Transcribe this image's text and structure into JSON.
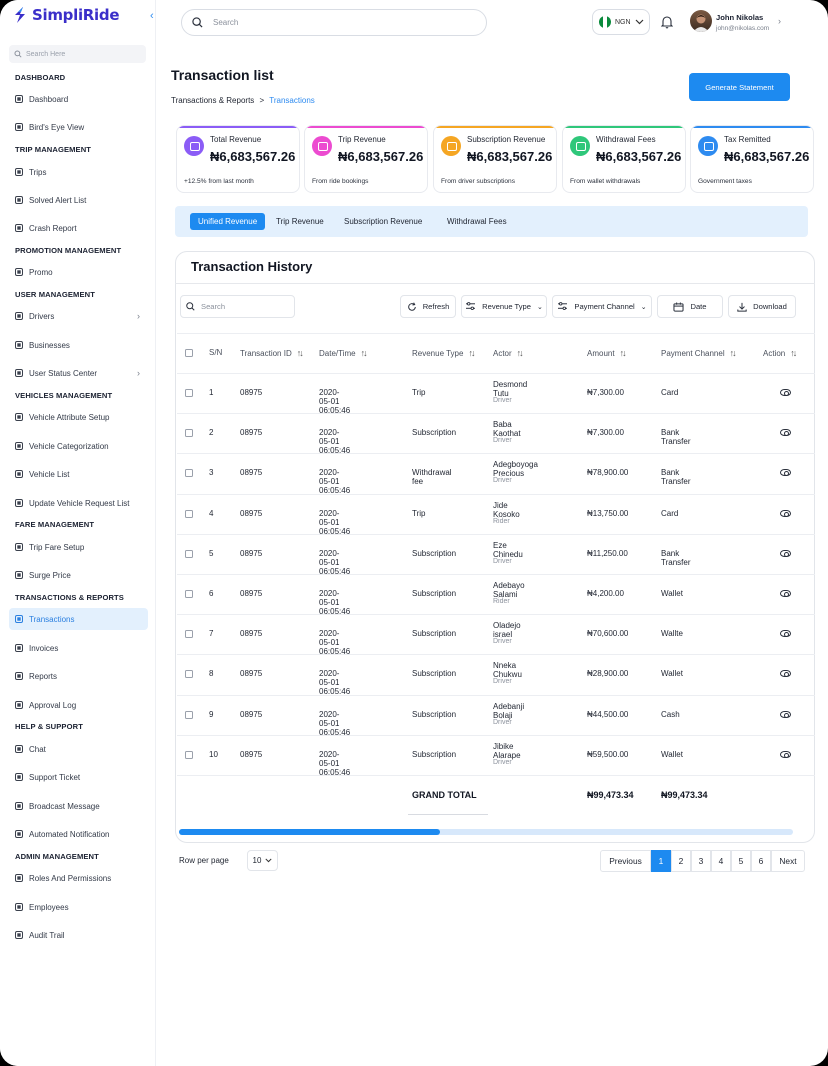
{
  "app": {
    "brand": "SimpliRide",
    "brand_color": "#3b2fc9",
    "accent": "#1d8af0"
  },
  "sidebar": {
    "search_placeholder": "Search Here",
    "sections": [
      {
        "label": "DASHBOARD",
        "items": [
          {
            "label": "Dashboard",
            "icon": "grid-icon"
          },
          {
            "label": "Bird's Eye View",
            "icon": "eye-icon"
          }
        ]
      },
      {
        "label": "TRIP MANAGEMENT",
        "items": [
          {
            "label": "Trips",
            "icon": "list-icon"
          },
          {
            "label": "Solved Alert List",
            "icon": "check-icon"
          },
          {
            "label": "Crash Report",
            "icon": "alert-icon"
          }
        ]
      },
      {
        "label": "PROMOTION MANAGEMENT",
        "items": [
          {
            "label": "Promo",
            "icon": "tag-icon"
          }
        ]
      },
      {
        "label": "USER MANAGEMENT",
        "items": [
          {
            "label": "Drivers",
            "icon": "driver-icon",
            "chevron": true
          },
          {
            "label": "Businesses",
            "icon": "briefcase-icon"
          },
          {
            "label": "User Status Center",
            "icon": "user-icon",
            "chevron": true
          }
        ]
      },
      {
        "label": "VEHICLES MANAGEMENT",
        "items": [
          {
            "label": "Vehicle Attribute Setup",
            "icon": "car-icon"
          },
          {
            "label": "Vehicle Categorization",
            "icon": "car-icon"
          },
          {
            "label": "Vehicle List",
            "icon": "car-icon"
          },
          {
            "label": "Update Vehicle Request List",
            "icon": "car-icon"
          }
        ]
      },
      {
        "label": "FARE MANAGEMENT",
        "items": [
          {
            "label": "Trip Fare Setup",
            "icon": "fare-icon"
          },
          {
            "label": "Surge Price",
            "icon": "surge-icon"
          }
        ]
      },
      {
        "label": "TRANSACTIONS & REPORTS",
        "items": [
          {
            "label": "Transactions",
            "icon": "transactions-icon",
            "active": true
          },
          {
            "label": "Invoices",
            "icon": "invoice-icon"
          },
          {
            "label": "Reports",
            "icon": "report-icon"
          },
          {
            "label": "Approval Log",
            "icon": "log-icon"
          }
        ]
      },
      {
        "label": "HELP & SUPPORT",
        "items": [
          {
            "label": "Chat",
            "icon": "chat-icon"
          },
          {
            "label": "Support Ticket",
            "icon": "ticket-icon"
          },
          {
            "label": "Broadcast Message",
            "icon": "broadcast-icon"
          },
          {
            "label": "Automated Notification",
            "icon": "notification-icon"
          }
        ]
      },
      {
        "label": "ADMIN MANAGEMENT",
        "items": [
          {
            "label": "Roles And Permissions",
            "icon": "roles-icon"
          },
          {
            "label": "Employees",
            "icon": "employees-icon"
          },
          {
            "label": "Audit Trail",
            "icon": "audit-icon"
          }
        ]
      }
    ]
  },
  "header": {
    "search_placeholder": "Search",
    "currency": "NGN",
    "user_name": "John Nikolas",
    "user_email": "john@nikolas.com"
  },
  "page": {
    "title": "Transaction list",
    "breadcrumb_parent": "Transactions & Reports",
    "breadcrumb_sep": ">",
    "breadcrumb_current": "Transactions",
    "generate_button": "Generate Statement"
  },
  "cards": [
    {
      "label": "Total Revenue",
      "value": "₦6,683,567.26",
      "sub": "+12.5% from last month",
      "color": "#8b5cf6"
    },
    {
      "label": "Trip Revenue",
      "value": "₦6,683,567.26",
      "sub": "From ride bookings",
      "color": "#ec4bd0"
    },
    {
      "label": "Subscription Revenue",
      "value": "₦6,683,567.26",
      "sub": "From driver subscriptions",
      "color": "#f5a623"
    },
    {
      "label": "Withdrawal Fees",
      "value": "₦6,683,567.26",
      "sub": "From wallet withdrawals",
      "color": "#2fc77a"
    },
    {
      "label": "Tax Remitted",
      "value": "₦6,683,567.26",
      "sub": "Government taxes",
      "color": "#2e8bf0"
    }
  ],
  "tabs": [
    "Unified Revenue",
    "Trip Revenue",
    "Subscription Revenue",
    "Withdrawal Fees"
  ],
  "history": {
    "title": "Transaction History",
    "search_placeholder": "Search",
    "refresh": "Refresh",
    "revenue_type": "Revenue Type",
    "payment_channel": "Payment Channel",
    "date": "Date",
    "download": "Download",
    "columns": [
      "S/N",
      "Transaction ID",
      "Date/Time",
      "Revenue Type",
      "Actor",
      "Amount",
      "Payment Channel",
      "Action"
    ],
    "rows": [
      {
        "sn": "1",
        "id": "08975",
        "dt": "2020-05-01 06:05:46",
        "type": "Trip",
        "actor": "Desmond Tutu",
        "role": "Driver",
        "amount": "₦7,300.00",
        "channel": "Card"
      },
      {
        "sn": "2",
        "id": "08975",
        "dt": "2020-05-01 06:05:46",
        "type": "Subscription",
        "actor": "Baba Kaothat",
        "role": "Driver",
        "amount": "₦7,300.00",
        "channel": "Bank Transfer"
      },
      {
        "sn": "3",
        "id": "08975",
        "dt": "2020-05-01 06:05:46",
        "type": "Withdrawal fee",
        "actor": "Adegboyoga Precious",
        "role": "Driver",
        "amount": "₦78,900.00",
        "channel": "Bank Transfer"
      },
      {
        "sn": "4",
        "id": "08975",
        "dt": "2020-05-01 06:05:46",
        "type": "Trip",
        "actor": "Jide Kosoko",
        "role": "Rider",
        "amount": "₦13,750.00",
        "channel": "Card"
      },
      {
        "sn": "5",
        "id": "08975",
        "dt": "2020-05-01 06:05:46",
        "type": "Subscription",
        "actor": "Eze Chinedu",
        "role": "Driver",
        "amount": "₦11,250.00",
        "channel": "Bank Transfer"
      },
      {
        "sn": "6",
        "id": "08975",
        "dt": "2020-05-01 06:05:46",
        "type": "Subscription",
        "actor": "Adebayo Salami",
        "role": "Rider",
        "amount": "₦4,200.00",
        "channel": "Wallet"
      },
      {
        "sn": "7",
        "id": "08975",
        "dt": "2020-05-01 06:05:46",
        "type": "Subscription",
        "actor": "Oladejo israel",
        "role": "Driver",
        "amount": "₦70,600.00",
        "channel": "Wallte"
      },
      {
        "sn": "8",
        "id": "08975",
        "dt": "2020-05-01 06:05:46",
        "type": "Subscription",
        "actor": "Nneka Chukwu",
        "role": "Driver",
        "amount": "₦28,900.00",
        "channel": "Wallet"
      },
      {
        "sn": "9",
        "id": "08975",
        "dt": "2020-05-01 06:05:46",
        "type": "Subscription",
        "actor": "Adebanji Bolaji",
        "role": "Driver",
        "amount": "₦44,500.00",
        "channel": "Cash"
      },
      {
        "sn": "10",
        "id": "08975",
        "dt": "2020-05-01 06:05:46",
        "type": "Subscription",
        "actor": "Jibike Alarape",
        "role": "Driver",
        "amount": "₦59,500.00",
        "channel": "Wallet"
      }
    ],
    "grand_total_label": "GRAND TOTAL",
    "grand_total_amount": "₦99,473.34",
    "grand_total_channel": "₦99,473.34",
    "scroll_progress": 0.425
  },
  "pagination": {
    "rows_label": "Row per page",
    "rows_value": "10",
    "previous": "Previous",
    "pages": [
      "1",
      "2",
      "3",
      "4",
      "5",
      "6"
    ],
    "current": "1",
    "next": "Next"
  }
}
